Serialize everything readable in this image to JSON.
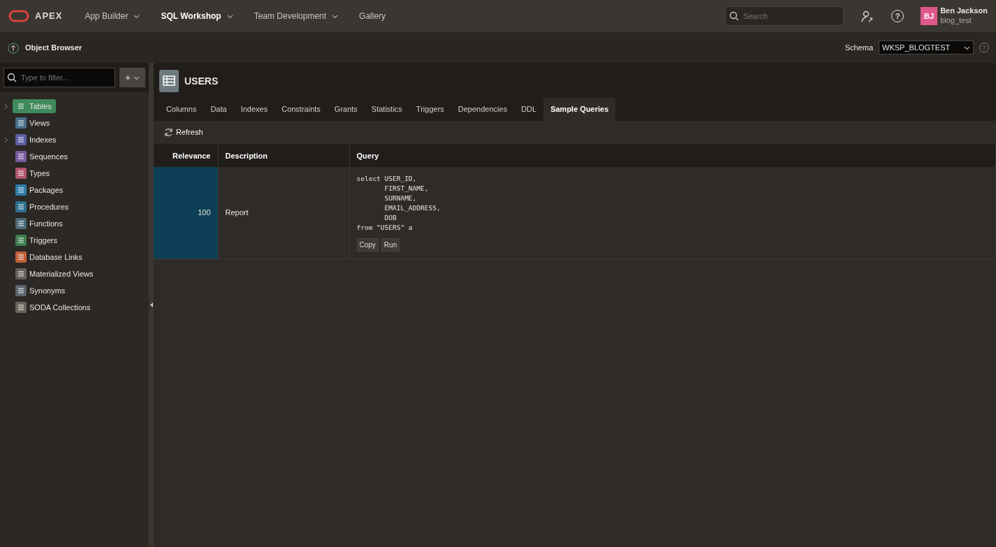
{
  "app": {
    "logo_text": "APEX"
  },
  "nav": [
    {
      "label": "App Builder",
      "has_menu": true,
      "selected": false
    },
    {
      "label": "SQL Workshop",
      "has_menu": true,
      "selected": true
    },
    {
      "label": "Team Development",
      "has_menu": true,
      "selected": false
    },
    {
      "label": "Gallery",
      "has_menu": false,
      "selected": false
    }
  ],
  "search": {
    "placeholder": "Search"
  },
  "help": {
    "label": "?"
  },
  "user": {
    "initials": "BJ",
    "name": "Ben Jackson",
    "workspace": "blog_test",
    "color": "#e0578a"
  },
  "page": {
    "title": "Object Browser"
  },
  "schema": {
    "label": "Schema",
    "value": "WKSP_BLOGTEST",
    "help_label": "?"
  },
  "filter": {
    "placeholder": "Type to filter...",
    "add_label": "+"
  },
  "sidebar": {
    "items": [
      {
        "label": "Tables",
        "color": "#3f8a5c",
        "expandable": true,
        "selected": true
      },
      {
        "label": "Views",
        "color": "#4a6f8a",
        "expandable": false,
        "selected": false
      },
      {
        "label": "Indexes",
        "color": "#5a5fa0",
        "expandable": true,
        "selected": false
      },
      {
        "label": "Sequences",
        "color": "#7a5a9e",
        "expandable": false,
        "selected": false
      },
      {
        "label": "Types",
        "color": "#b0566e",
        "expandable": false,
        "selected": false
      },
      {
        "label": "Packages",
        "color": "#2f7ea8",
        "expandable": false,
        "selected": false
      },
      {
        "label": "Procedures",
        "color": "#2f6f8e",
        "expandable": false,
        "selected": false
      },
      {
        "label": "Functions",
        "color": "#4d6a78",
        "expandable": false,
        "selected": false
      },
      {
        "label": "Triggers",
        "color": "#3f7f4e",
        "expandable": false,
        "selected": false
      },
      {
        "label": "Database Links",
        "color": "#c0603a",
        "expandable": false,
        "selected": false
      },
      {
        "label": "Materialized Views",
        "color": "#66615c",
        "expandable": false,
        "selected": false
      },
      {
        "label": "Synonyms",
        "color": "#5c6470",
        "expandable": false,
        "selected": false
      },
      {
        "label": "SODA Collections",
        "color": "#6b655d",
        "expandable": false,
        "selected": false
      }
    ]
  },
  "object": {
    "name": "USERS"
  },
  "tabs": [
    {
      "label": "Columns",
      "selected": false
    },
    {
      "label": "Data",
      "selected": false
    },
    {
      "label": "Indexes",
      "selected": false
    },
    {
      "label": "Constraints",
      "selected": false
    },
    {
      "label": "Grants",
      "selected": false
    },
    {
      "label": "Statistics",
      "selected": false
    },
    {
      "label": "Triggers",
      "selected": false
    },
    {
      "label": "Dependencies",
      "selected": false
    },
    {
      "label": "DDL",
      "selected": false
    },
    {
      "label": "Sample Queries",
      "selected": true
    }
  ],
  "toolbar": {
    "refresh": "Refresh"
  },
  "table": {
    "columns": [
      "Relevance",
      "Description",
      "Query"
    ],
    "rows": [
      {
        "relevance": "100",
        "description": "Report",
        "query": "select USER_ID,\n       FIRST_NAME,\n       SURNAME,\n       EMAIL_ADDRESS,\n       DOB\nfrom \"USERS\" a",
        "actions": [
          "Copy",
          "Run"
        ]
      }
    ]
  }
}
